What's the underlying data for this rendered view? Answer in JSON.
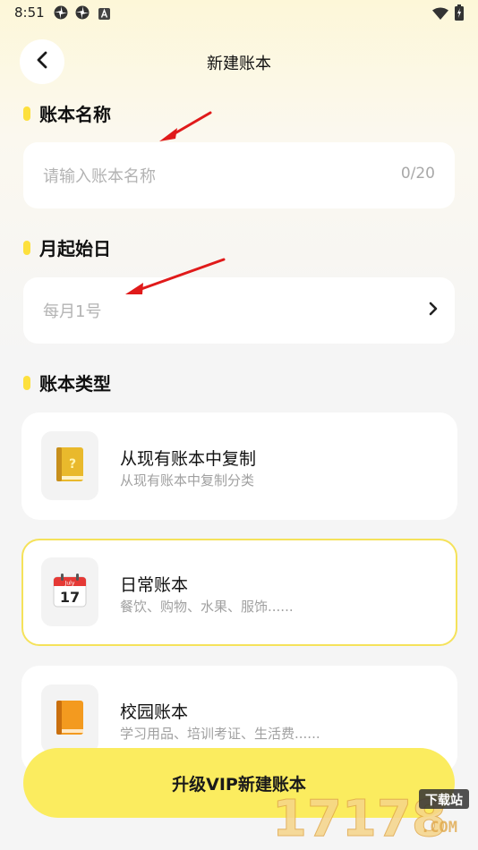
{
  "status_bar": {
    "time": "8:51",
    "icons": [
      "pinwheel-icon",
      "pinwheel-icon",
      "a-badge-icon",
      "wifi-icon",
      "battery-charging-icon"
    ]
  },
  "header": {
    "title": "新建账本",
    "back_icon": "chevron-left-icon"
  },
  "form": {
    "name_section": {
      "label": "账本名称",
      "placeholder": "请输入账本名称",
      "counter": "0/20"
    },
    "start_day_section": {
      "label": "月起始日",
      "value": "每月1号",
      "chevron_icon": "chevron-right-icon"
    },
    "type_section": {
      "label": "账本类型",
      "options": [
        {
          "title": "从现有账本中复制",
          "subtitle": "从现有账本中复制分类",
          "icon": "yellow-book-question-icon",
          "selected": false
        },
        {
          "title": "日常账本",
          "subtitle": "餐饮、购物、水果、服饰......",
          "icon": "calendar-july-17-icon",
          "selected": true
        },
        {
          "title": "校园账本",
          "subtitle": "学习用品、培训考证、生活费......",
          "icon": "orange-book-icon",
          "selected": false
        }
      ]
    }
  },
  "footer": {
    "vip_button_label": "升级VIP新建账本"
  },
  "watermark": {
    "number": "17178",
    "tag": "下载站",
    "suffix": ".COM"
  },
  "colors": {
    "accent": "#fde03d",
    "button": "#fbec5f",
    "selected_border": "#f5e25a",
    "annotation_arrow": "#e01a1a"
  }
}
